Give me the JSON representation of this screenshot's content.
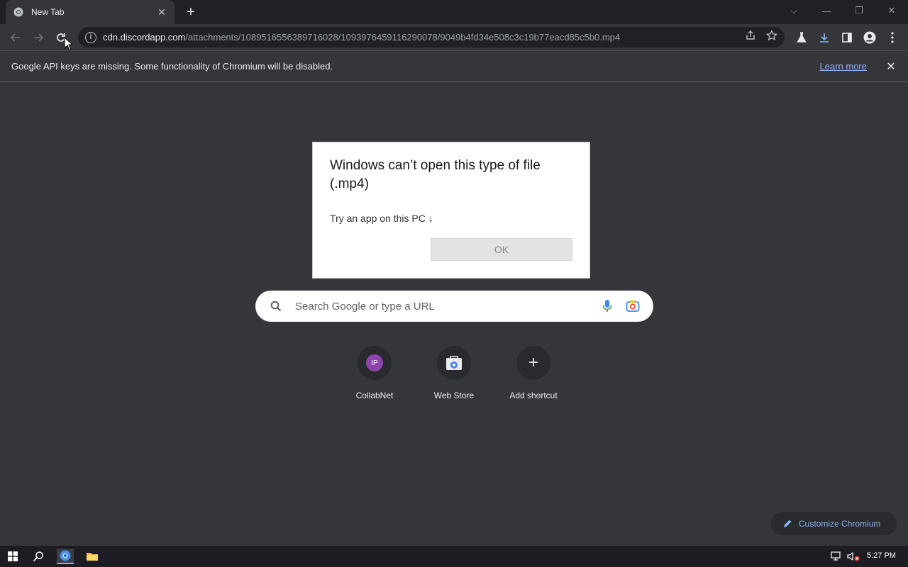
{
  "tab": {
    "title": "New Tab",
    "close_glyph": "✕",
    "favicon": "chromium-icon"
  },
  "new_tab_glyph": "+",
  "window_controls": {
    "tab_search": "⌵",
    "minimize": "—",
    "restore": "❐",
    "close": "✕"
  },
  "address_bar": {
    "host": "cdn.discordapp.com",
    "path": "/attachments/1089516556389716028/1093976459116290078/9049b4fd34e508c3c19b77eacd85c5b0.mp4",
    "info_glyph": "i"
  },
  "infobar": {
    "message": "Google API keys are missing. Some functionality of Chromium will be disabled.",
    "link": "Learn more",
    "close_glyph": "✕"
  },
  "dialog": {
    "title": "Windows can’t open this type of file (.mp4)",
    "try_app": "Try an app on this PC ↓",
    "ok_label": "OK"
  },
  "search": {
    "placeholder": "Search Google or type a URL"
  },
  "shortcuts": [
    {
      "label": "CollabNet",
      "icon_text": "IP",
      "icon_color": "#8e44ad"
    },
    {
      "label": "Web Store",
      "icon": "web-store-icon"
    },
    {
      "label": "Add shortcut",
      "icon": "plus-icon",
      "icon_text": "+"
    }
  ],
  "customize": {
    "label": "Customize Chromium"
  },
  "taskbar": {
    "time": "5:27 PM"
  },
  "colors": {
    "accent": "#8ab4f8",
    "background": "#35363a",
    "frame": "#202124"
  }
}
